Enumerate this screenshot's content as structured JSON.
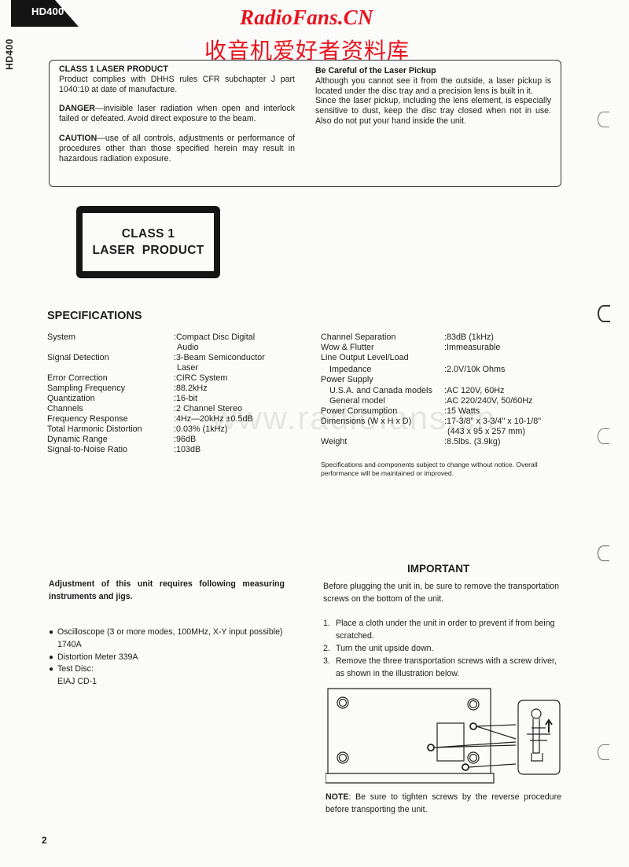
{
  "header": {
    "model_tab": "HD400",
    "side_label": "HD400",
    "watermark_title": "RadioFans.CN",
    "watermark_subtitle": "收音机爱好者资料库"
  },
  "warning_box": {
    "left": {
      "heading": "CLASS 1 LASER PRODUCT",
      "compliance": "Product complies with DHHS rules CFR subchapter J part 1040:10 at date of manufacture.",
      "danger_label": "DANGER",
      "danger_text": "—invisible laser radiation when open and interlock failed or defeated. Avoid direct exposure to the beam.",
      "caution_label": "CAUTION",
      "caution_text": "—use of all controls, adjustments or performance of procedures other than those specified herein may result in hazardous radiation exposure."
    },
    "right": {
      "heading": "Be Careful of the Laser Pickup",
      "para1": "Although you cannot see it from the outside, a laser pickup is located under the disc tray and a precision lens is built in it.",
      "para2": "Since the laser pickup, including the lens element, is especially sensitive to dust, keep the disc tray closed when not in use. Also do not put your hand inside the unit."
    }
  },
  "class_label": {
    "line1": "CLASS 1",
    "line2": "LASER  PRODUCT"
  },
  "specifications": {
    "title": "SPECIFICATIONS",
    "left": [
      {
        "key": "System",
        "value": ":Compact Disc Digital",
        "cont": "Audio"
      },
      {
        "key": "Signal Detection",
        "value": ":3-Beam Semiconductor",
        "cont": "Laser"
      },
      {
        "key": "Error Correction",
        "value": ":CIRC System"
      },
      {
        "key": "Sampling Frequency",
        "value": ":88.2kHz"
      },
      {
        "key": "Quantization",
        "value": ":16-bit"
      },
      {
        "key": "Channels",
        "value": ":2 Channel Stereo"
      },
      {
        "key": "Frequency Response",
        "value": ":4Hz—20kHz ±0.5dB"
      },
      {
        "key": "Total Harmonic Distortion",
        "value": ":0.03% (1kHz)"
      },
      {
        "key": "Dynamic Range",
        "value": ":96dB"
      },
      {
        "key": "Signal-to-Noise Ratio",
        "value": ":103dB"
      }
    ],
    "right": [
      {
        "key": "Channel Separation",
        "value": ":83dB (1kHz)"
      },
      {
        "key": "Wow & Flutter",
        "value": ":Immeasurable"
      },
      {
        "key": "Line Output Level/Load",
        "value": ""
      },
      {
        "key": "Impedance",
        "value": ":2.0V/10k Ohms"
      },
      {
        "key": "Power Supply",
        "value": ""
      },
      {
        "key": "U.S.A. and Canada models",
        "value": ":AC 120V, 60Hz"
      },
      {
        "key": "General model",
        "value": ":AC 220/240V, 50/60Hz"
      },
      {
        "key": "Power Consumption",
        "value": ":15 Watts"
      },
      {
        "key": "Dimensions (W x H x D)",
        "value": ":17-3/8\" x 3-3/4\" x 10-1/8\"",
        "cont": "(443 x 95 x 257 mm)"
      },
      {
        "key": "Weight",
        "value": ":8.5lbs. (3.9kg)"
      }
    ],
    "note": "Specifications and components subject to change without notice. Overall performance will be maintained or improved.",
    "watermark": "www.radiofans.cn"
  },
  "adjustment": {
    "title": "Adjustment of this unit requires following measuring instruments and jigs.",
    "items": [
      {
        "text": "Oscilloscope (3 or more modes, 100MHz, X-Y input possible) 1740A"
      },
      {
        "text": "Distortion Meter 339A"
      },
      {
        "text": "Test Disc:",
        "sub": "EIAJ CD-1"
      }
    ],
    "bullet": "●"
  },
  "important": {
    "title": "IMPORTANT",
    "intro": "Before plugging the unit in, be sure to remove the transportation screws on the bottom of the unit.",
    "steps": [
      {
        "num": "1.",
        "text": "Place a cloth under the unit in order to prevent if from being scratched."
      },
      {
        "num": "2.",
        "text": "Turn the unit upside down."
      },
      {
        "num": "3.",
        "text": "Remove the three transportation screws with a screw driver, as shown in the illustration below."
      }
    ],
    "note_label": "NOTE",
    "note_text": ": Be sure to tighten screws by the reverse procedure before transporting the unit."
  },
  "footer": {
    "page_number": "2"
  }
}
